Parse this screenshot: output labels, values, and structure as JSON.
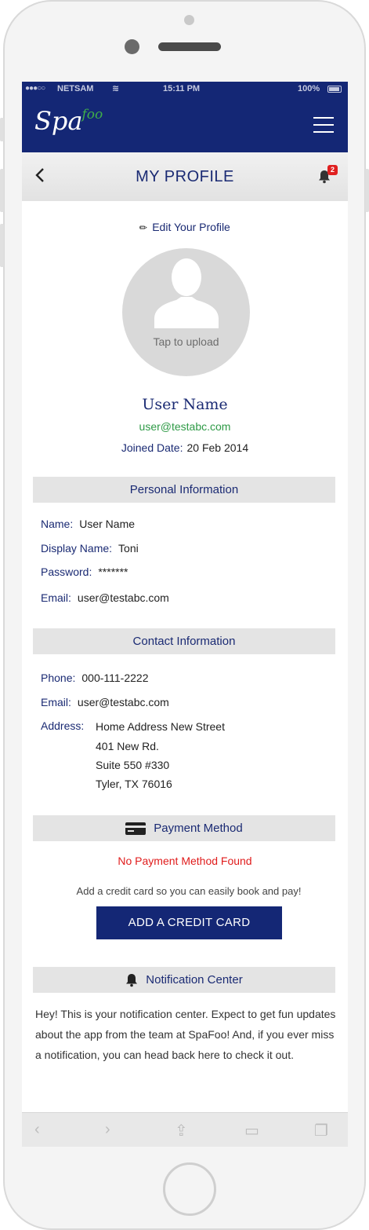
{
  "statusbar": {
    "signal_dots": "●●●○○",
    "carrier": "NETSAM",
    "wifi_icon": "wifi-icon",
    "time": "15:11 PM",
    "battery": "100%"
  },
  "appbar": {
    "logo_main": "Spa",
    "logo_accent": "foo",
    "menu_icon": "hamburger-menu-icon"
  },
  "titlebar": {
    "back_icon": "chevron-left-icon",
    "title": "MY PROFILE",
    "bell_icon": "bell-icon",
    "notification_count": "2"
  },
  "profile": {
    "edit_label": "Edit Your Profile",
    "avatar_hint": "Tap to upload",
    "name": "User Name",
    "email": "user@testabc.com",
    "joined_label": "Joined Date:",
    "joined_value": "20 Feb 2014"
  },
  "personal": {
    "heading": "Personal Information",
    "name_label": "Name:",
    "name_value": "User Name",
    "display_label": "Display Name:",
    "display_value": "Toni",
    "password_label": "Password:",
    "password_value": "*******",
    "email_label": "Email:",
    "email_value": "user@testabc.com"
  },
  "contact": {
    "heading": "Contact Information",
    "phone_label": "Phone:",
    "phone_value": "000-111-2222",
    "email_label": "Email:",
    "email_value": "user@testabc.com",
    "address_label": "Address:",
    "address_lines": [
      "Home Address New Street",
      "401 New Rd.",
      "Suite 550 #330",
      "Tyler, TX 76016"
    ]
  },
  "payment": {
    "heading": "Payment Method",
    "icon": "credit-card-icon",
    "empty_message": "No Payment Method Found",
    "hint": "Add a credit card so you can easily book and pay!",
    "button_label": "ADD A CREDIT CARD"
  },
  "notifications": {
    "heading": "Notification Center",
    "icon": "bell-icon",
    "body": "Hey! This is your notification center. Expect to get fun updates about the app from the team at SpaFoo! And, if you ever miss a notification, you can head back here to check it out."
  },
  "safari": {
    "back": "‹",
    "forward": "›",
    "share": "⇪",
    "bookmarks": "▭",
    "tabs": "❐"
  },
  "colors": {
    "brand_navy": "#142775",
    "accent_green": "#2e9a46",
    "error_red": "#e01b1b",
    "section_gray": "#e4e4e4"
  }
}
